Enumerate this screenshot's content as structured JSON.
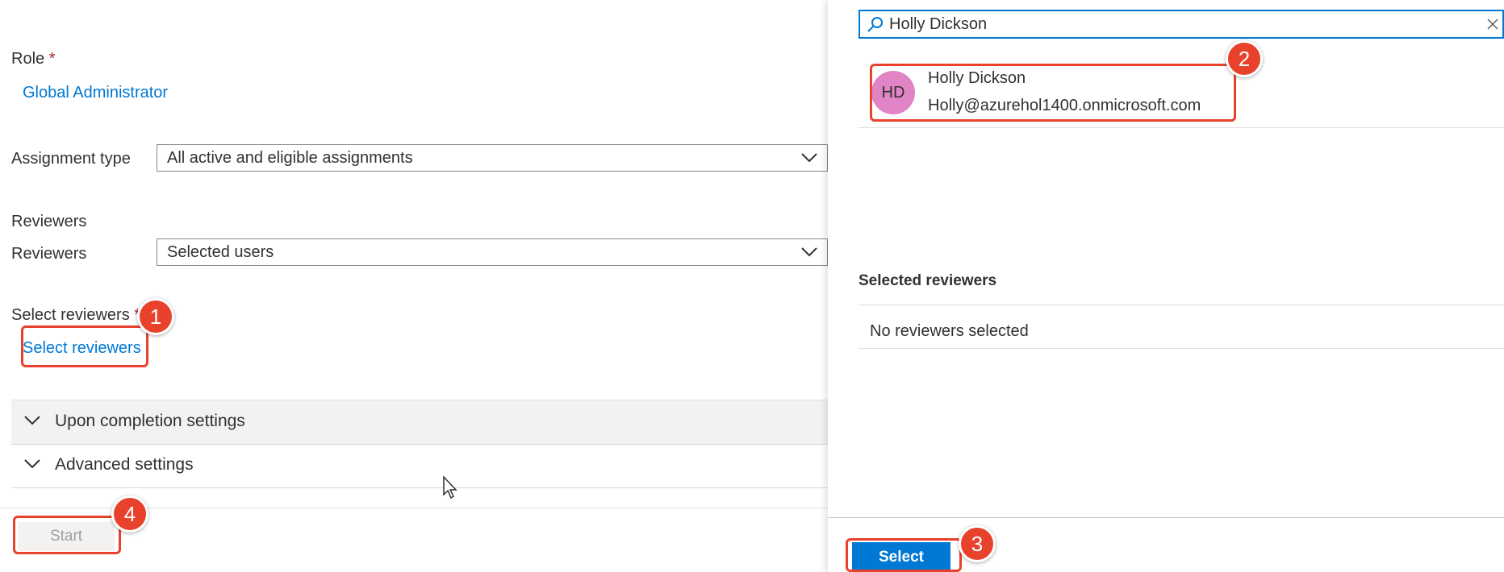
{
  "form": {
    "role_label": "Role",
    "required_mark": "*",
    "role_value": "Global Administrator",
    "assignment_type_label": "Assignment type",
    "assignment_type_value": "All active and eligible assignments",
    "reviewers_heading": "Reviewers",
    "reviewers_label": "Reviewers",
    "reviewers_value": "Selected users",
    "select_reviewers_label": "Select reviewers",
    "select_reviewers_link": "Select reviewers",
    "sections": [
      {
        "label": "Upon completion settings"
      },
      {
        "label": "Advanced settings"
      }
    ],
    "start_button": "Start"
  },
  "panel": {
    "search_value": "Holly Dickson",
    "result": {
      "initials": "HD",
      "name": "Holly Dickson",
      "email": "Holly@azurehol1400.onmicrosoft.com"
    },
    "selected_heading": "Selected reviewers",
    "selected_empty": "No reviewers selected",
    "select_button": "Select"
  },
  "annotations": {
    "step1": "1",
    "step2": "2",
    "step3": "3",
    "step4": "4"
  },
  "colors": {
    "accent": "#0078d4",
    "annotation": "#e8412c",
    "avatar": "#e084c6"
  }
}
